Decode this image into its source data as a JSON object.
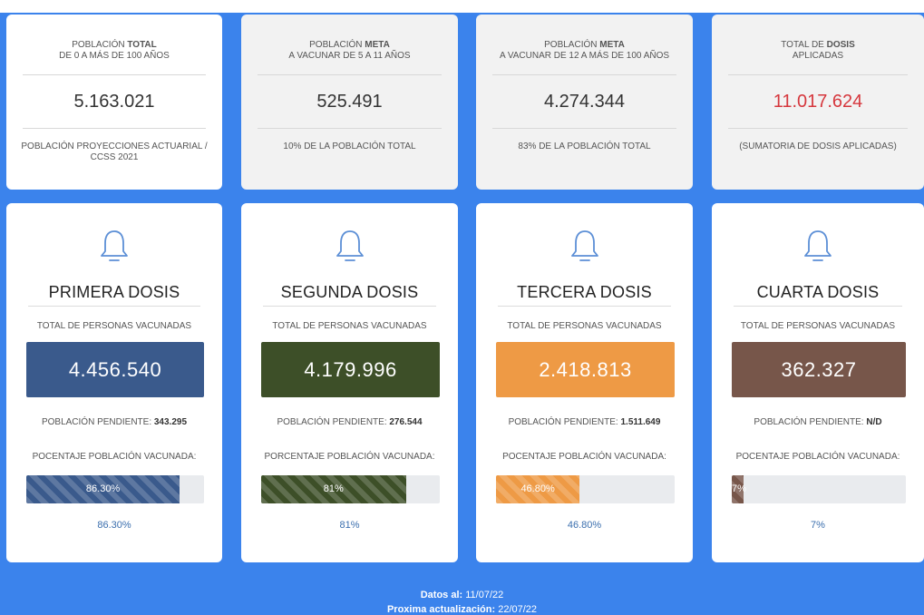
{
  "stats": [
    {
      "title_pre": "POBLACIÓN ",
      "title_bold": "TOTAL",
      "title_line2": "DE 0 A MÁS DE 100 AÑOS",
      "value": "5.163.021",
      "foot": "POBLACIÓN PROYECCIONES ACTUARIAL / CCSS 2021"
    },
    {
      "title_pre": "POBLACIÓN ",
      "title_bold": "META",
      "title_line2": "A VACUNAR DE 5 A 11 AÑOS",
      "value": "525.491",
      "foot": "10% DE LA POBLACIÓN TOTAL"
    },
    {
      "title_pre": "POBLACIÓN ",
      "title_bold": "META",
      "title_line2": "A VACUNAR DE 12 A MÁS DE 100 AÑOS",
      "value": "4.274.344",
      "foot": "83% DE LA POBLACIÓN TOTAL"
    },
    {
      "title_pre": "TOTAL DE ",
      "title_bold": "DOSIS",
      "title_line2": "APLICADAS",
      "value": "11.017.624",
      "foot": "(SUMATORIA DE DOSIS APLICADAS)"
    }
  ],
  "doses": [
    {
      "title": "PRIMERA DOSIS",
      "subtitle": "TOTAL DE PERSONAS VACUNADAS",
      "total": "4.456.540",
      "pending_label": "POBLACIÓN PENDIENTE: ",
      "pending_value": "343.295",
      "pct_label": "POCENTAJE POBLACIÓN VACUNADA:",
      "bar_text": "86.30%",
      "pct_text": "86.30%",
      "progress": 86.3,
      "color": "#3a5a8c"
    },
    {
      "title": "SEGUNDA DOSIS",
      "subtitle": "TOTAL DE PERSONAS VACUNADAS",
      "total": "4.179.996",
      "pending_label": "POBLACIÓN PENDIENTE: ",
      "pending_value": "276.544",
      "pct_label": "PORCENTAJE POBLACIÓN VACUNADA:",
      "bar_text": "81%",
      "pct_text": "81%",
      "progress": 81,
      "color": "#3d4f28"
    },
    {
      "title": "TERCERA DOSIS",
      "subtitle": "TOTAL DE PERSONAS VACUNADAS",
      "total": "2.418.813",
      "pending_label": "POBLACIÓN PENDIENTE: ",
      "pending_value": "1.511.649",
      "pct_label": "POCENTAJE POBLACIÓN VACUNADA:",
      "bar_text": "46.80%",
      "pct_text": "46.80%",
      "progress": 46.8,
      "color": "#ee9a45"
    },
    {
      "title": "CUARTA DOSIS",
      "subtitle": "TOTAL DE PERSONAS VACUNADAS",
      "total": "362.327",
      "pending_label": "POBLACIÓN PENDIENTE: ",
      "pending_value": "N/D",
      "pct_label": "POCENTAJE POBLACIÓN VACUNADA:",
      "bar_text": "7%",
      "pct_text": "7%",
      "progress": 7,
      "color": "#77564a"
    }
  ],
  "footer": {
    "data_label": "Datos al:",
    "data_value": " 11/07/22",
    "next_label": "Proxima actualización:",
    "next_value": " 22/07/22"
  },
  "colors": {
    "accent_blue": "#3b83ec",
    "red_value": "#d6383e",
    "pct_text": "#3b6fae"
  },
  "icons": [
    "bell-icon"
  ]
}
